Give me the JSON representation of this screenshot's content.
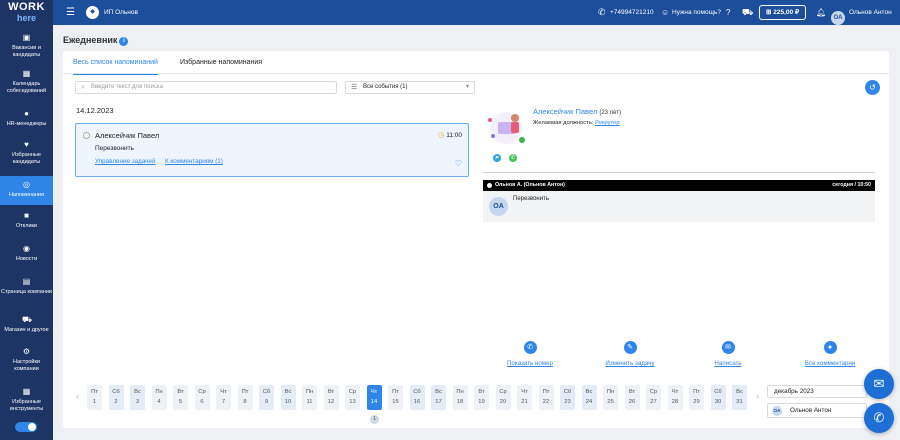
{
  "brand": {
    "line1": "WORK",
    "line2": "here"
  },
  "sidebar": {
    "items": [
      {
        "icon": "briefcase-icon",
        "label": "Вакансии и кандидаты"
      },
      {
        "icon": "calendar-icon",
        "label": "Календарь собеседований"
      },
      {
        "icon": "users-icon",
        "label": "HR-менеджеры"
      },
      {
        "icon": "heart-icon",
        "label": "Избранные кандидаты"
      },
      {
        "icon": "bell-icon",
        "label": "Напоминания"
      },
      {
        "icon": "chat-icon",
        "label": "Отклики"
      },
      {
        "icon": "globe-icon",
        "label": "Новости"
      },
      {
        "icon": "building-icon",
        "label": "Страница компании"
      },
      {
        "icon": "cart-icon",
        "label": "Магазин и другое"
      },
      {
        "icon": "gear-icon",
        "label": "Настройки компании"
      },
      {
        "icon": "grid-icon",
        "label": "Избранные инструменты"
      }
    ]
  },
  "topbar": {
    "company": "ИП Ольнов",
    "phone": "+74994721210",
    "help": "Нужна помощь?",
    "balance": "225,00 ₽",
    "user_initials": "OA",
    "user_name": "Ольнов Антон"
  },
  "page_title": "Ежедневник",
  "tabs": {
    "all": "Весь список напоминаний",
    "fav": "Избранные напоминания"
  },
  "search": {
    "placeholder": "Введите текст для поиска"
  },
  "filter": {
    "value": "Все события (1)"
  },
  "reminder": {
    "date": "14.12.2023",
    "name": "Алексейчик Павел",
    "time": "11:00",
    "text": "Перезвонить",
    "link1": "Управление задачей",
    "link2": "К комментариям (1)"
  },
  "candidate": {
    "name": "Алексейчик Павел",
    "age": "(23 лет)",
    "position_label": "Желаемая должность:",
    "position": "Рекрутер"
  },
  "comment": {
    "author": "Ольнов А. (Ольнов Антон)",
    "when": "сегодня / 10:50",
    "initials": "OA",
    "text": "Перезвонить"
  },
  "actions": {
    "show_number": "Показать номер",
    "edit_task": "Изменить задачу",
    "write": "Написать",
    "all_comments": "Все комментарии"
  },
  "days": [
    {
      "wd": "Пт",
      "d": "1",
      "we": false
    },
    {
      "wd": "Сб",
      "d": "2",
      "we": true
    },
    {
      "wd": "Вс",
      "d": "3",
      "we": true
    },
    {
      "wd": "Пн",
      "d": "4",
      "we": false
    },
    {
      "wd": "Вт",
      "d": "5",
      "we": false
    },
    {
      "wd": "Ср",
      "d": "6",
      "we": false
    },
    {
      "wd": "Чт",
      "d": "7",
      "we": false
    },
    {
      "wd": "Пт",
      "d": "8",
      "we": false
    },
    {
      "wd": "Сб",
      "d": "9",
      "we": true
    },
    {
      "wd": "Вс",
      "d": "10",
      "we": true
    },
    {
      "wd": "Пн",
      "d": "11",
      "we": false
    },
    {
      "wd": "Вт",
      "d": "12",
      "we": false
    },
    {
      "wd": "Ср",
      "d": "13",
      "we": false
    },
    {
      "wd": "Чт",
      "d": "14",
      "we": false,
      "active": true
    },
    {
      "wd": "Пт",
      "d": "15",
      "we": false
    },
    {
      "wd": "Сб",
      "d": "16",
      "we": true
    },
    {
      "wd": "Вс",
      "d": "17",
      "we": true
    },
    {
      "wd": "Пн",
      "d": "18",
      "we": false
    },
    {
      "wd": "Вт",
      "d": "19",
      "we": false
    },
    {
      "wd": "Ср",
      "d": "20",
      "we": false
    },
    {
      "wd": "Чт",
      "d": "21",
      "we": false
    },
    {
      "wd": "Пт",
      "d": "22",
      "we": false
    },
    {
      "wd": "Сб",
      "d": "23",
      "we": true
    },
    {
      "wd": "Вс",
      "d": "24",
      "we": true
    },
    {
      "wd": "Пн",
      "d": "25",
      "we": false
    },
    {
      "wd": "Вт",
      "d": "26",
      "we": false
    },
    {
      "wd": "Ср",
      "d": "27",
      "we": false
    },
    {
      "wd": "Чт",
      "d": "28",
      "we": false
    },
    {
      "wd": "Пт",
      "d": "29",
      "we": false
    },
    {
      "wd": "Сб",
      "d": "30",
      "we": true
    },
    {
      "wd": "Вс",
      "d": "31",
      "we": true
    }
  ],
  "day_marker": "1",
  "month": "декабрь 2023",
  "user_filter": {
    "initials": "OA",
    "name": "Ольнов Антон"
  },
  "colors": {
    "accent": "#2f86e8",
    "sidebar": "#1c3565",
    "topbar": "#1d4e9c"
  }
}
